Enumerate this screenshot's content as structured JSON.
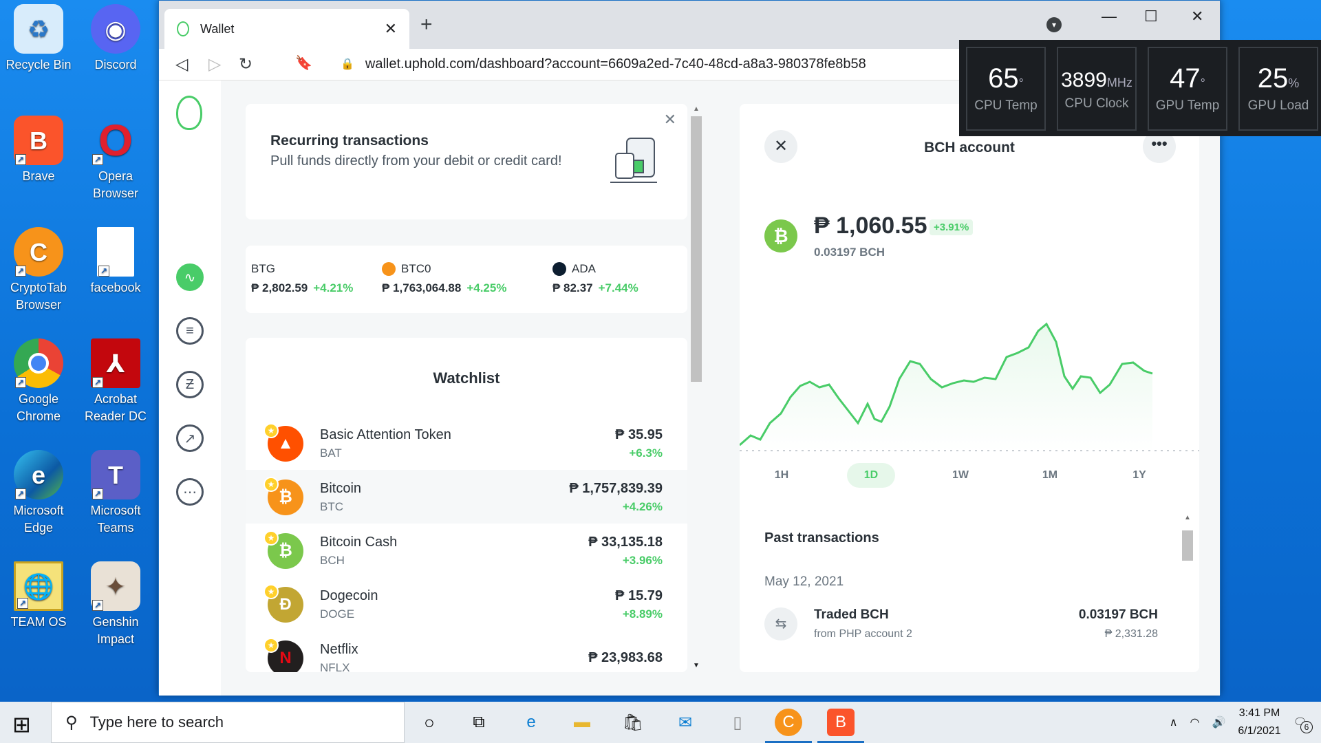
{
  "desktop": {
    "icons": [
      {
        "label": "Recycle Bin",
        "color": "#9ec9ef",
        "glyph": "♻"
      },
      {
        "label": "Discord",
        "color": "#5865f2",
        "glyph": "◉"
      },
      {
        "label": "Brave",
        "color": "#fb542b",
        "glyph": "🦁"
      },
      {
        "label": "Opera Browser",
        "color": "#e0202e",
        "glyph": "O"
      },
      {
        "label": "CryptoTab Browser",
        "color": "#f7931a",
        "glyph": "C"
      },
      {
        "label": "facebook",
        "color": "#ffffff",
        "glyph": ""
      },
      {
        "label": "Google Chrome",
        "color": "#4285f4",
        "glyph": "◎"
      },
      {
        "label": "Acrobat Reader DC",
        "color": "#c3070d",
        "glyph": "⅄"
      },
      {
        "label": "Microsoft Edge",
        "color": "#0c7ed2",
        "glyph": "e"
      },
      {
        "label": "Microsoft Teams",
        "color": "#5b5fc7",
        "glyph": "T"
      },
      {
        "label": "TEAM OS",
        "color": "#2ba84a",
        "glyph": "🌐"
      },
      {
        "label": "Genshin Impact",
        "color": "#e9e1d6",
        "glyph": "✦"
      }
    ]
  },
  "browser": {
    "tab_title": "Wallet",
    "url": "wallet.uphold.com/dashboard?account=6609a2ed-7c40-48cd-a8a3-980378fe8b58"
  },
  "recurring": {
    "title": "Recurring transactions",
    "subtitle": "Pull funds directly from your debit or credit card!"
  },
  "ticker": [
    {
      "symbol": "BTG",
      "price": "₱ 2,802.59",
      "change": "+4.21%",
      "color": "#eba809"
    },
    {
      "symbol": "BTC0",
      "price": "₱ 1,763,064.88",
      "change": "+4.25%",
      "color": "#f7931a"
    },
    {
      "symbol": "ADA",
      "price": "₱ 82.37",
      "change": "+7.44%",
      "color": "#0d1e30"
    }
  ],
  "watchlist": {
    "title": "Watchlist",
    "items": [
      {
        "name": "Basic Attention Token",
        "symbol": "BAT",
        "price": "₱ 35.95",
        "change": "+6.3%",
        "color": "#ff5000",
        "glyph": "▲"
      },
      {
        "name": "Bitcoin",
        "symbol": "BTC",
        "price": "₱ 1,757,839.39",
        "change": "+4.26%",
        "color": "#f7931a",
        "glyph": "₿"
      },
      {
        "name": "Bitcoin Cash",
        "symbol": "BCH",
        "price": "₱ 33,135.18",
        "change": "+3.96%",
        "color": "#7bc84c",
        "glyph": "₿"
      },
      {
        "name": "Dogecoin",
        "symbol": "DOGE",
        "price": "₱ 15.79",
        "change": "+8.89%",
        "color": "#c2a633",
        "glyph": "Ð"
      },
      {
        "name": "Netflix",
        "symbol": "NFLX",
        "price": "₱ 23,983.68",
        "change": "",
        "color": "#221f1f",
        "glyph": "N"
      }
    ]
  },
  "bch": {
    "title": "BCH account",
    "balance": "₱ 1,060.55",
    "change": "+3.91%",
    "amount": "0.03197 BCH",
    "periods": [
      "1H",
      "1D",
      "1W",
      "1M",
      "1Y"
    ],
    "active_period": "1D",
    "past_title": "Past transactions",
    "date": "May 12, 2021",
    "tx_title": "Traded BCH",
    "tx_sub": "from PHP account 2",
    "tx_amount": "0.03197 BCH",
    "tx_value": "₱ 2,331.28",
    "chart_color": "#49cc68"
  },
  "gadget": [
    {
      "value": "65",
      "unit": "°",
      "label": "CPU Temp"
    },
    {
      "value": "3899",
      "unit": "MHz",
      "label": "CPU Clock"
    },
    {
      "value": "47",
      "unit": "°",
      "label": "GPU Temp"
    },
    {
      "value": "25",
      "unit": "%",
      "label": "GPU Load"
    }
  ],
  "taskbar": {
    "search_placeholder": "Type here to search",
    "time": "3:41 PM",
    "date": "6/1/2021",
    "notifications": "6"
  }
}
